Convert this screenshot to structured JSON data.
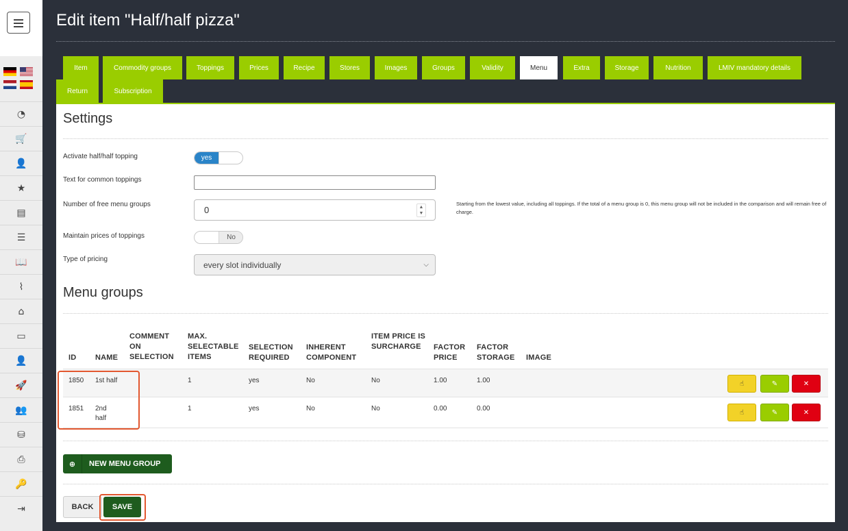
{
  "page": {
    "title": "Edit item \"Half/half pizza\""
  },
  "sidebar": {
    "icons": [
      "dashboard-icon",
      "cart-icon",
      "add-user-icon",
      "star-icon",
      "archive-icon",
      "list-icon",
      "book-icon",
      "chart-icon",
      "home-icon",
      "monitor-icon",
      "user-icon",
      "rocket-icon",
      "users-icon",
      "database-icon",
      "printer-icon",
      "key-icon",
      "logout-icon"
    ],
    "glyphs": [
      "◔",
      "🛒",
      "👤",
      "★",
      "▤",
      "☰",
      "📖",
      "⌇",
      "⌂",
      "▭",
      "👤",
      "🚀",
      "👥",
      "⛁",
      "⎙",
      "🔑",
      "⇥"
    ],
    "flags": [
      "de",
      "us",
      "nl",
      "es"
    ]
  },
  "tabs": [
    {
      "label": "Item"
    },
    {
      "label": "Commodity groups"
    },
    {
      "label": "Toppings"
    },
    {
      "label": "Prices"
    },
    {
      "label": "Recipe"
    },
    {
      "label": "Stores"
    },
    {
      "label": "Images"
    },
    {
      "label": "Groups"
    },
    {
      "label": "Validity"
    },
    {
      "label": "Menu"
    },
    {
      "label": "Extra"
    },
    {
      "label": "Storage"
    },
    {
      "label": "Nutrition"
    },
    {
      "label": "LMIV mandatory details"
    },
    {
      "label": "Return"
    },
    {
      "label": "Subscription"
    }
  ],
  "active_tab": "Menu",
  "settings": {
    "title": "Settings",
    "activate_label": "Activate half/half topping",
    "activate_value": "yes",
    "common_text_label": "Text for common toppings",
    "common_text_value": "",
    "free_groups_label": "Number of free menu groups",
    "free_groups_value": "0",
    "free_groups_help": "Starting from the lowest value, including all toppings. If the total of a menu group is 0, this menu group will not be included in the comparison and will remain free of charge.",
    "maintain_label": "Maintain prices of toppings",
    "maintain_value": "No",
    "pricing_label": "Type of pricing",
    "pricing_value": "every slot individually"
  },
  "menu_groups": {
    "title": "Menu groups",
    "headers": {
      "id": "ID",
      "name": "NAME",
      "comment": "COMMENT ON SELECTION",
      "max": "MAX. SELECTABLE ITEMS",
      "required": "SELECTION REQUIRED",
      "inherent": "INHERENT COMPONENT",
      "surcharge": "ITEM PRICE IS SURCHARGE",
      "factor_price": "FACTOR PRICE",
      "factor_storage": "FACTOR STORAGE",
      "image": "IMAGE"
    },
    "rows": [
      {
        "id": "1850",
        "name": "1st half",
        "comment": "",
        "max": "1",
        "required": "yes",
        "inherent": "No",
        "surcharge": "No",
        "factor_price": "1.00",
        "factor_storage": "1.00"
      },
      {
        "id": "1851",
        "name": "2nd half",
        "comment": "",
        "max": "1",
        "required": "yes",
        "inherent": "No",
        "surcharge": "No",
        "factor_price": "0.00",
        "factor_storage": "0.00"
      }
    ],
    "new_button": "NEW MENU GROUP"
  },
  "footer": {
    "back": "BACK",
    "save": "SAVE"
  },
  "colors": {
    "accent_green": "#9acd00",
    "dark_green": "#1e5c1e",
    "toggle_blue": "#2a84c8",
    "highlight": "#e2572f"
  }
}
